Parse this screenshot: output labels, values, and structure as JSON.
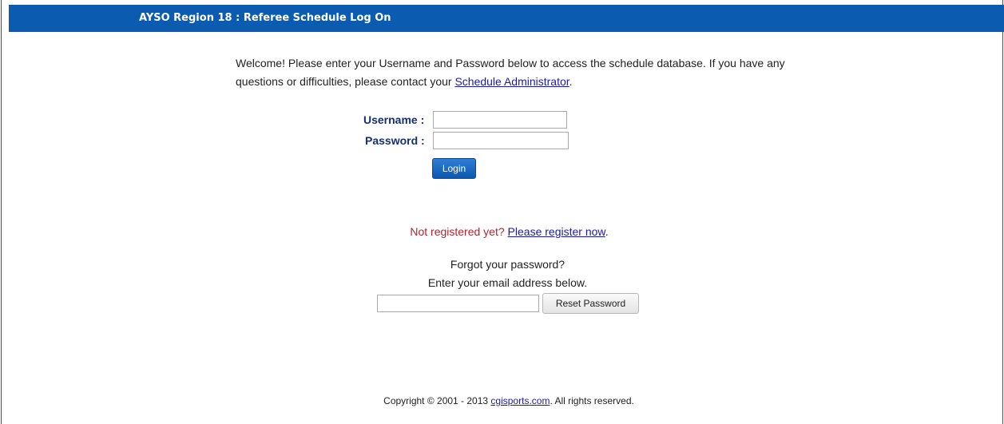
{
  "header": {
    "title": "AYSO Region 18 : Referee Schedule Log On"
  },
  "welcome": {
    "text": "Welcome! Please enter your Username and Password below to access the schedule database. If you have any questions or difficulties, please contact your ",
    "link_text": "Schedule Administrator",
    "suffix": "."
  },
  "login_form": {
    "username_label": "Username :",
    "username_value": "",
    "password_label": "Password :",
    "password_value": "",
    "login_button": "Login"
  },
  "register": {
    "prompt": "Not registered yet?",
    "link_text": "Please register now",
    "suffix": "."
  },
  "forgot": {
    "line1": "Forgot your password?",
    "line2": "Enter your email address below.",
    "email_value": "",
    "reset_button": "Reset Password"
  },
  "footer": {
    "prefix": "Copyright © 2001 - 2013 ",
    "link_text": "cgisports.com",
    "suffix": ". All rights reserved."
  },
  "colors": {
    "header_bg": "#0b5cb0",
    "label_color": "#16306b",
    "link_color": "#1a1aa8",
    "not_registered_color": "#b0262e"
  }
}
